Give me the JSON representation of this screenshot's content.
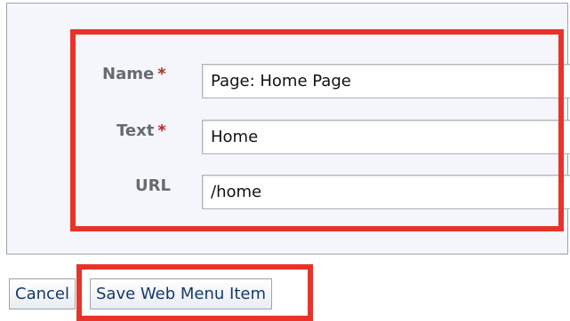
{
  "form": {
    "name": {
      "label": "Name",
      "required_marker": "*",
      "value": "Page: Home Page"
    },
    "text": {
      "label": "Text",
      "required_marker": "*",
      "value": "Home"
    },
    "url": {
      "label": "URL",
      "value": "/home"
    }
  },
  "actions": {
    "cancel_label": "Cancel",
    "save_label": "Save Web Menu Item"
  },
  "colors": {
    "highlight": "#e8332a",
    "required": "#b02a1e",
    "button_text": "#15386e",
    "panel_bg": "#f4f6fb"
  }
}
